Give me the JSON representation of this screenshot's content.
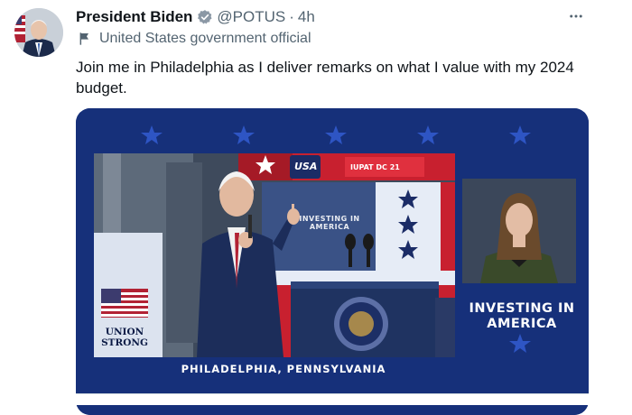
{
  "tweet": {
    "author_name": "President Biden",
    "handle": "@POTUS",
    "separator": "·",
    "time": "4h",
    "account_label": "United States government official",
    "text": "Join me in Philadelphia as I deliver remarks on what I value with my 2024 budget."
  },
  "media": {
    "backdrop_line1": "INVESTING IN",
    "backdrop_line2": "AMERICA",
    "banner_usa": "USA",
    "banner_iupat": "IUPAT DC 21",
    "union_line1": "UNION",
    "union_line2": "STRONG",
    "right_title_line1": "INVESTING IN",
    "right_title_line2": "AMERICA",
    "location": "PHILADELPHIA, PENNSYLVANIA"
  },
  "icons": {
    "verified": "verified-badge-icon",
    "more": "more-options-icon",
    "label": "flag-icon"
  },
  "colors": {
    "verified_badge": "#8b98a5",
    "secondary_text": "#536471",
    "media_background": "#16307a",
    "banner_red": "#c8202f"
  }
}
